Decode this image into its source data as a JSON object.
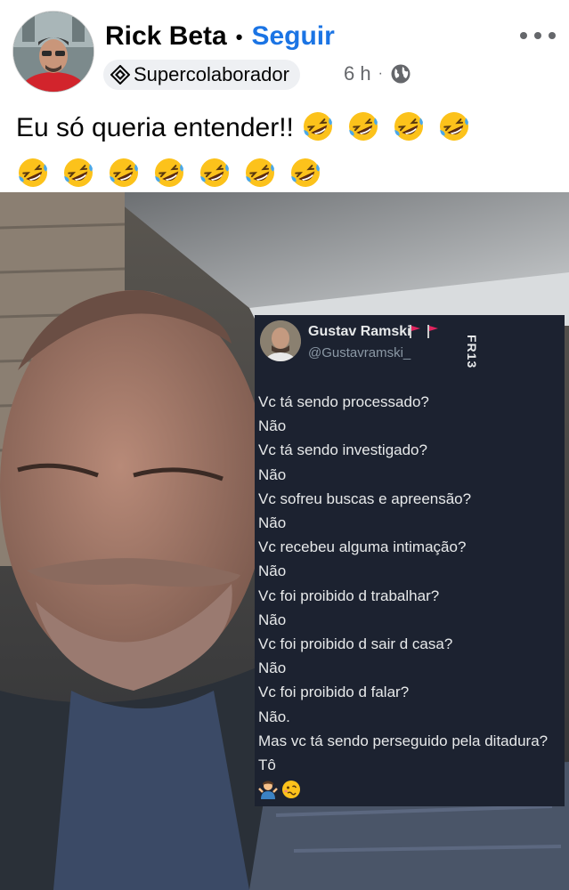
{
  "post": {
    "author": "Rick Beta",
    "separator": "•",
    "follow_label": "Seguir",
    "badge_label": "Supercolaborador",
    "time": "6 h",
    "meta_separator": "·",
    "privacy_icon": "globe-icon",
    "more_icon": "more-horizontal-icon",
    "caption_text": "Eu só queria entender!!",
    "caption_emoji": "rolling-on-floor-laughing-emoji",
    "caption_emoji_count": 11
  },
  "tweet": {
    "name": "Gustav Ramski",
    "handle": "@Gustavramski_",
    "logo_text": "FR13",
    "lines": [
      "Vc tá sendo processado?",
      "Não",
      "Vc tá sendo investigado?",
      "Não",
      "Vc sofreu buscas e apreensão?",
      "Não",
      "Vc recebeu alguma intimação?",
      "Não",
      "Vc foi proibido d trabalhar?",
      "Não",
      "Vc foi proibido d sair d casa?",
      "Não",
      "Vc foi proibido d falar?",
      "Não.",
      "Mas vc tá sendo perseguido pela ditadura?",
      "Tô"
    ],
    "end_emojis": [
      "person-shrugging-emoji",
      "woozy-face-emoji"
    ]
  },
  "colors": {
    "follow": "#1b74e4",
    "tweet_background": "#1c2230",
    "flag": "#e0245e"
  }
}
